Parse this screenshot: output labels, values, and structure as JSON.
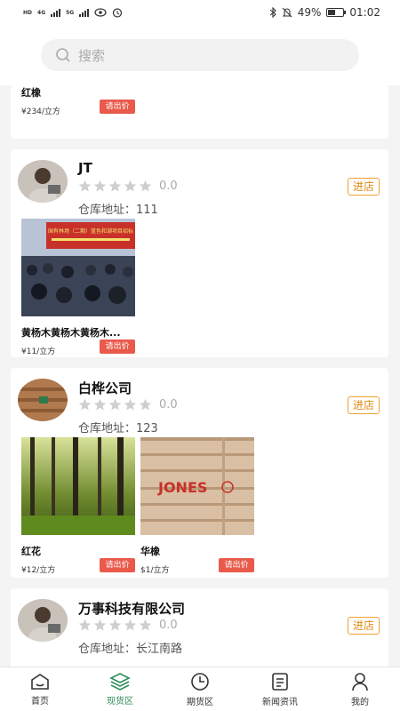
{
  "status": {
    "net1": "HD",
    "net2": "4G",
    "net3": "5G",
    "battery": "49%",
    "time": "01:02",
    "battery_level": 0.49
  },
  "search": {
    "placeholder": "搜索"
  },
  "stores": [
    {
      "name": "",
      "products": [
        {
          "name": "红橡",
          "price": "¥234/立方",
          "quote": "请出价"
        }
      ]
    },
    {
      "name": "JT",
      "rating": "0.0",
      "address_label": "仓库地址：",
      "address": "111",
      "enter": "进店",
      "products": [
        {
          "name": "黄杨木黄杨木黄杨木...",
          "price": "¥11/立方",
          "quote": "请出价"
        }
      ]
    },
    {
      "name": "白桦公司",
      "rating": "0.0",
      "address_label": "仓库地址：",
      "address": "123",
      "enter": "进店",
      "products": [
        {
          "name": "红花",
          "price": "¥12/立方",
          "quote": "请出价"
        },
        {
          "name": "华橡",
          "price": "$1/立方",
          "quote": "请出价",
          "stamp": "JONES"
        }
      ]
    },
    {
      "name": "万事科技有限公司",
      "rating": "0.0",
      "address_label": "仓库地址：",
      "address": "长江南路",
      "enter": "进店"
    }
  ],
  "banner_text": "国有林场（二期）蓝色和湖项目招标",
  "tabs": [
    {
      "label": "首页",
      "icon": "home-icon",
      "active": false
    },
    {
      "label": "现货区",
      "icon": "stack-icon",
      "active": true
    },
    {
      "label": "期货区",
      "icon": "clock-icon",
      "active": false
    },
    {
      "label": "新闻资讯",
      "icon": "news-icon",
      "active": false
    },
    {
      "label": "我的",
      "icon": "user-icon",
      "active": false
    }
  ],
  "colors": {
    "accent": "#2e8b57",
    "quote": "#e95a4b",
    "enter": "#f0a030"
  }
}
